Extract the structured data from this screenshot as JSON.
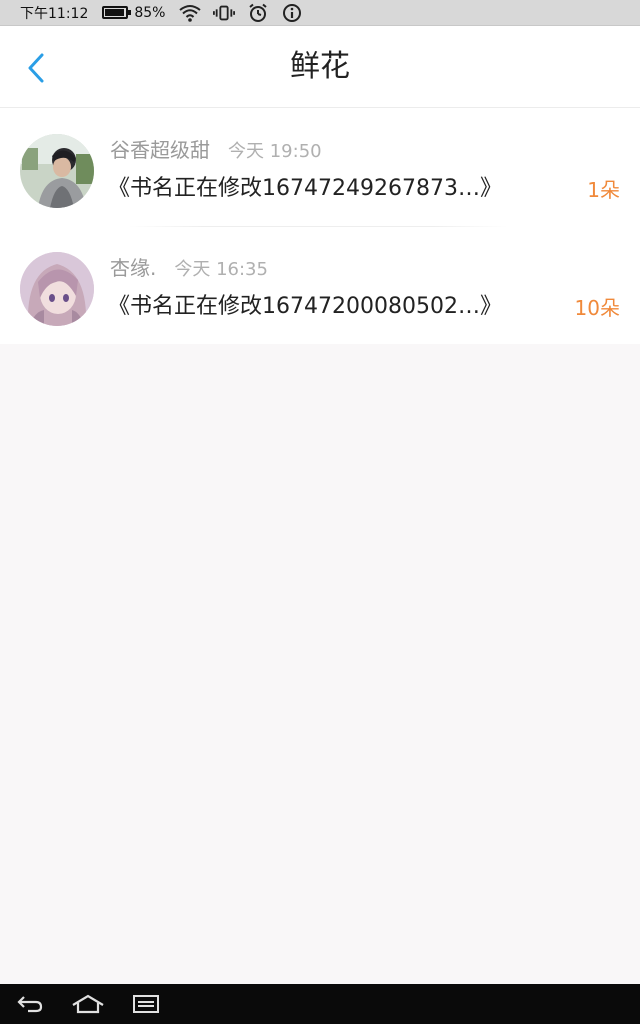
{
  "status_bar": {
    "time": "下午11:12",
    "battery_percent": "85%",
    "battery_level": 0.85,
    "icons": [
      "battery-icon",
      "wifi-icon",
      "vibrate-icon",
      "alarm-icon",
      "info-icon"
    ]
  },
  "header": {
    "title": "鲜花",
    "back_icon": "chevron-left-icon"
  },
  "list": {
    "items": [
      {
        "username": "谷香超级甜",
        "time": "今天 19:50",
        "book_title": "《书名正在修改16747249267873…》",
        "count": "1朵",
        "avatar": "photo-avatar"
      },
      {
        "username": "杏缘.",
        "time": "今天 16:35",
        "book_title": "《书名正在修改16747200080502…》",
        "count": "10朵",
        "avatar": "anime-avatar"
      }
    ]
  },
  "nav_bar": {
    "icons": [
      "back-icon",
      "home-icon",
      "menu-icon"
    ]
  },
  "colors": {
    "accent_blue": "#2a9ee6",
    "count_orange": "#f0893a",
    "page_bg": "#f9f7f8"
  }
}
